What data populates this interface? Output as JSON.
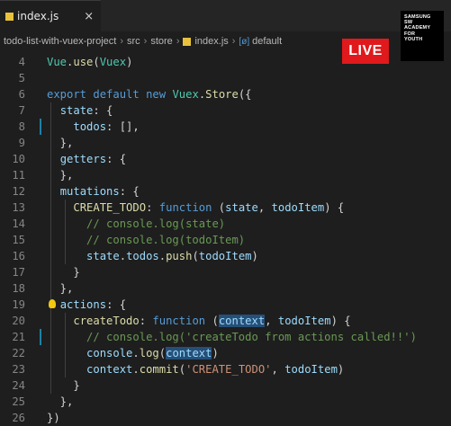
{
  "tab": {
    "label": "index.js",
    "close": "×"
  },
  "breadcrumb": [
    "todo-list-with-vuex-project",
    "src",
    "store",
    "index.js",
    "default"
  ],
  "live_badge": "LIVE",
  "logo_lines": [
    "SAMSUNG",
    "SW",
    "ACADEMY",
    "FOR",
    "YOUTH"
  ],
  "lines": [
    {
      "n": 4,
      "code": "Vue.use(Vuex)"
    },
    {
      "n": 5,
      "code": ""
    },
    {
      "n": 6,
      "code": "export default new Vuex.Store({"
    },
    {
      "n": 7,
      "code": "  state: {"
    },
    {
      "n": 8,
      "code": "    todos: [],"
    },
    {
      "n": 9,
      "code": "  },"
    },
    {
      "n": 10,
      "code": "  getters: {"
    },
    {
      "n": 11,
      "code": "  },"
    },
    {
      "n": 12,
      "code": "  mutations: {"
    },
    {
      "n": 13,
      "code": "    CREATE_TODO: function (state, todoItem) {"
    },
    {
      "n": 14,
      "code": "      // console.log(state)"
    },
    {
      "n": 15,
      "code": "      // console.log(todoItem)"
    },
    {
      "n": 16,
      "code": "      state.todos.push(todoItem)"
    },
    {
      "n": 17,
      "code": "    }"
    },
    {
      "n": 18,
      "code": "  },"
    },
    {
      "n": 19,
      "code": "  actions: {"
    },
    {
      "n": 20,
      "code": "    createTodo: function (context, todoItem) {"
    },
    {
      "n": 21,
      "code": "      // console.log('createTodo from actions called!!')"
    },
    {
      "n": 22,
      "code": "      console.log(context)"
    },
    {
      "n": 23,
      "code": "      context.commit('CREATE_TODO', todoItem)"
    },
    {
      "n": 24,
      "code": "    }"
    },
    {
      "n": 25,
      "code": "  },"
    },
    {
      "n": 26,
      "code": "})"
    }
  ]
}
